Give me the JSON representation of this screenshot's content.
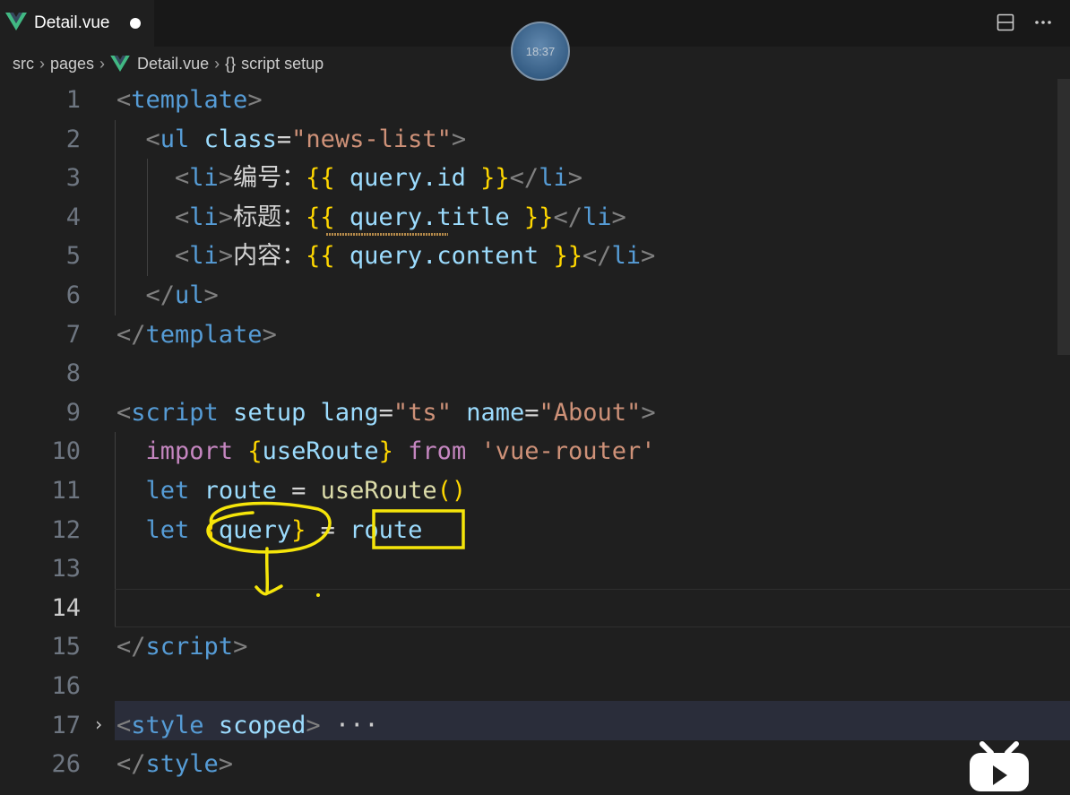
{
  "tab": {
    "filename": "Detail.vue",
    "icon": "vue-icon",
    "unsaved": true
  },
  "tab_actions": {
    "split": "split-editor-icon",
    "more": "more-actions-icon"
  },
  "breadcrumb": {
    "items": [
      "src",
      "pages",
      "Detail.vue"
    ],
    "symbol": "script setup",
    "symbol_icon": "braces-icon"
  },
  "overlay_clock": "18:37",
  "editor": {
    "active_line": "14",
    "lines": [
      {
        "n": "1",
        "tokens": [
          [
            "<",
            "punc"
          ],
          [
            "template",
            "tag"
          ],
          [
            ">",
            "punc"
          ]
        ]
      },
      {
        "n": "2",
        "tokens": [
          [
            "  ",
            "text"
          ],
          [
            "<",
            "punc"
          ],
          [
            "ul",
            "tag"
          ],
          [
            " ",
            "text"
          ],
          [
            "class",
            "attr"
          ],
          [
            "=",
            "text"
          ],
          [
            "\"news-list\"",
            "str"
          ],
          [
            ">",
            "punc"
          ]
        ]
      },
      {
        "n": "3",
        "tokens": [
          [
            "    ",
            "text"
          ],
          [
            "<",
            "punc"
          ],
          [
            "li",
            "tag"
          ],
          [
            ">",
            "punc"
          ],
          [
            "编号：",
            "text"
          ],
          [
            "{{",
            "brace"
          ],
          [
            " query.id ",
            "var"
          ],
          [
            "}}",
            "brace"
          ],
          [
            "</",
            "punc"
          ],
          [
            "li",
            "tag"
          ],
          [
            ">",
            "punc"
          ]
        ]
      },
      {
        "n": "4",
        "tokens": [
          [
            "    ",
            "text"
          ],
          [
            "<",
            "punc"
          ],
          [
            "li",
            "tag"
          ],
          [
            ">",
            "punc"
          ],
          [
            "标题：",
            "text"
          ],
          [
            "{{",
            "brace"
          ],
          [
            " query.title ",
            "var"
          ],
          [
            "}}",
            "brace"
          ],
          [
            "</",
            "punc"
          ],
          [
            "li",
            "tag"
          ],
          [
            ">",
            "punc"
          ]
        ]
      },
      {
        "n": "5",
        "tokens": [
          [
            "    ",
            "text"
          ],
          [
            "<",
            "punc"
          ],
          [
            "li",
            "tag"
          ],
          [
            ">",
            "punc"
          ],
          [
            "内容：",
            "text"
          ],
          [
            "{{",
            "brace"
          ],
          [
            " query.content ",
            "var"
          ],
          [
            "}}",
            "brace"
          ],
          [
            "</",
            "punc"
          ],
          [
            "li",
            "tag"
          ],
          [
            ">",
            "punc"
          ]
        ]
      },
      {
        "n": "6",
        "tokens": [
          [
            "  ",
            "text"
          ],
          [
            "</",
            "punc"
          ],
          [
            "ul",
            "tag"
          ],
          [
            ">",
            "punc"
          ]
        ]
      },
      {
        "n": "7",
        "tokens": [
          [
            "</",
            "punc"
          ],
          [
            "template",
            "tag"
          ],
          [
            ">",
            "punc"
          ]
        ]
      },
      {
        "n": "8",
        "tokens": []
      },
      {
        "n": "9",
        "tokens": [
          [
            "<",
            "punc"
          ],
          [
            "script",
            "tag"
          ],
          [
            " ",
            "text"
          ],
          [
            "setup",
            "attr"
          ],
          [
            " ",
            "text"
          ],
          [
            "lang",
            "attr"
          ],
          [
            "=",
            "text"
          ],
          [
            "\"ts\"",
            "str"
          ],
          [
            " ",
            "text"
          ],
          [
            "name",
            "attr"
          ],
          [
            "=",
            "text"
          ],
          [
            "\"About\"",
            "str"
          ],
          [
            ">",
            "punc"
          ]
        ]
      },
      {
        "n": "10",
        "tokens": [
          [
            "  ",
            "text"
          ],
          [
            "import",
            "kw"
          ],
          [
            " ",
            "text"
          ],
          [
            "{",
            "brace"
          ],
          [
            "useRoute",
            "var"
          ],
          [
            "}",
            "brace"
          ],
          [
            " ",
            "text"
          ],
          [
            "from",
            "kw"
          ],
          [
            " ",
            "text"
          ],
          [
            "'vue-router'",
            "str"
          ]
        ]
      },
      {
        "n": "11",
        "tokens": [
          [
            "  ",
            "text"
          ],
          [
            "let",
            "let"
          ],
          [
            " ",
            "text"
          ],
          [
            "route",
            "var"
          ],
          [
            " = ",
            "text"
          ],
          [
            "useRoute",
            "fn"
          ],
          [
            "()",
            "brace"
          ]
        ]
      },
      {
        "n": "12",
        "tokens": [
          [
            "  ",
            "text"
          ],
          [
            "let",
            "let"
          ],
          [
            " ",
            "text"
          ],
          [
            "{",
            "brace"
          ],
          [
            "query",
            "var"
          ],
          [
            "}",
            "brace"
          ],
          [
            " = ",
            "text"
          ],
          [
            "route",
            "var"
          ]
        ]
      },
      {
        "n": "13",
        "tokens": []
      },
      {
        "n": "14",
        "tokens": []
      },
      {
        "n": "15",
        "tokens": [
          [
            "</",
            "punc"
          ],
          [
            "script",
            "tag"
          ],
          [
            ">",
            "punc"
          ]
        ]
      },
      {
        "n": "16",
        "tokens": []
      },
      {
        "n": "17",
        "tokens": [
          [
            "<",
            "punc"
          ],
          [
            "style",
            "tag"
          ],
          [
            " ",
            "text"
          ],
          [
            "scoped",
            "attr"
          ],
          [
            ">",
            "punc"
          ],
          [
            " ···",
            "gray"
          ]
        ],
        "folded": true
      },
      {
        "n": "26",
        "tokens": [
          [
            "</",
            "punc"
          ],
          [
            "style",
            "tag"
          ],
          [
            ">",
            "punc"
          ]
        ]
      }
    ]
  },
  "colors": {
    "background": "#1f1f1f",
    "annotation": "#f5e50a",
    "tag": "#569cd6",
    "string": "#ce9178",
    "variable": "#9cdcfe"
  },
  "watermark": "bilibili-tv-icon"
}
